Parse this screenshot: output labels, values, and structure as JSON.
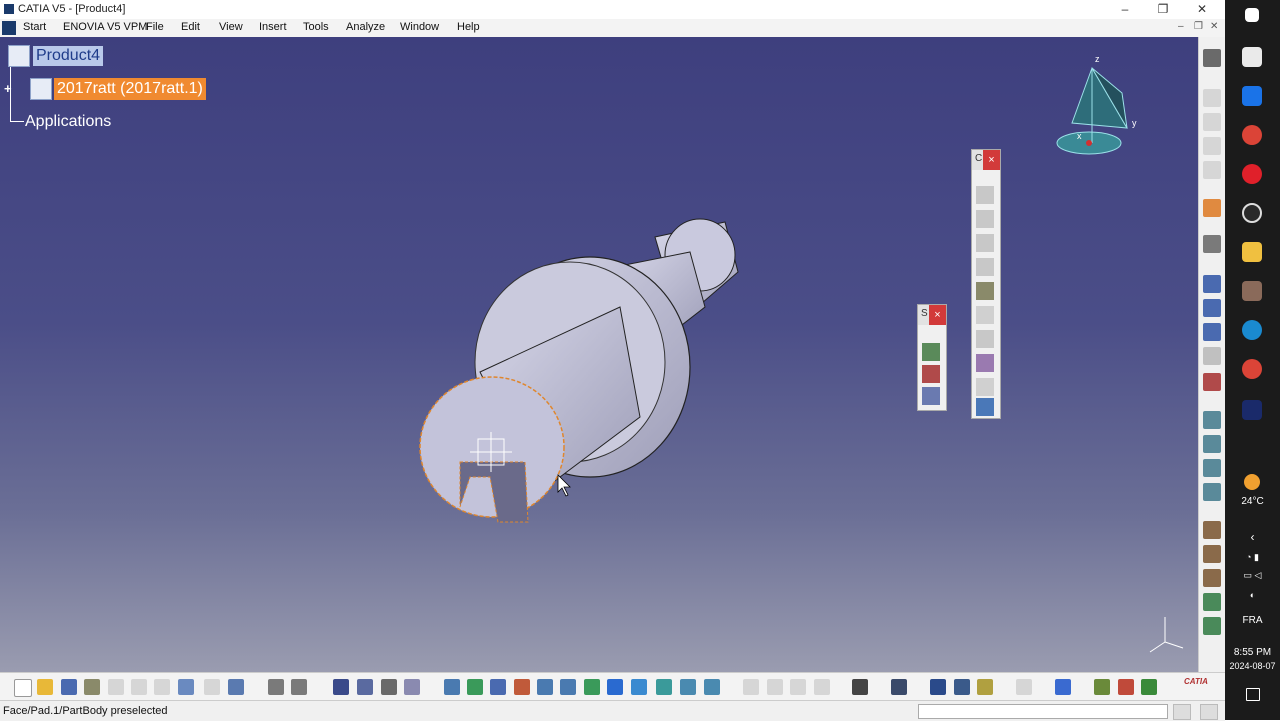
{
  "window": {
    "title": "CATIA V5 - [Product4]",
    "minimize": "–",
    "restore": "❐",
    "close": "✕"
  },
  "menu": {
    "start": "Start",
    "enovia": "ENOVIA V5 VPM",
    "file": "File",
    "edit": "Edit",
    "view": "View",
    "insert": "Insert",
    "tools": "Tools",
    "analyze": "Analyze",
    "window": "Window",
    "help": "Help"
  },
  "tree": {
    "root": "Product4",
    "child": "2017ratt (2017ratt.1)",
    "applications": "Applications"
  },
  "compass": {
    "z": "z",
    "y": "y",
    "x": "x"
  },
  "floating_toolbars": [
    {
      "label": "C",
      "close": "×"
    },
    {
      "label": "S",
      "close": "×"
    }
  ],
  "status": {
    "message": "Face/Pad.1/PartBody preselected"
  },
  "bottom_toolbar": {
    "logo": "CATIA"
  },
  "taskbar": {
    "weather": "24°C",
    "language": "FRA",
    "time": "8:55 PM",
    "date": "2024-08-07"
  },
  "colors": {
    "viewport_top": "#3e3f7e",
    "viewport_bottom": "#9a9cb0",
    "selection_orange": "#f08a30",
    "part_face": "#c8c8dc"
  }
}
